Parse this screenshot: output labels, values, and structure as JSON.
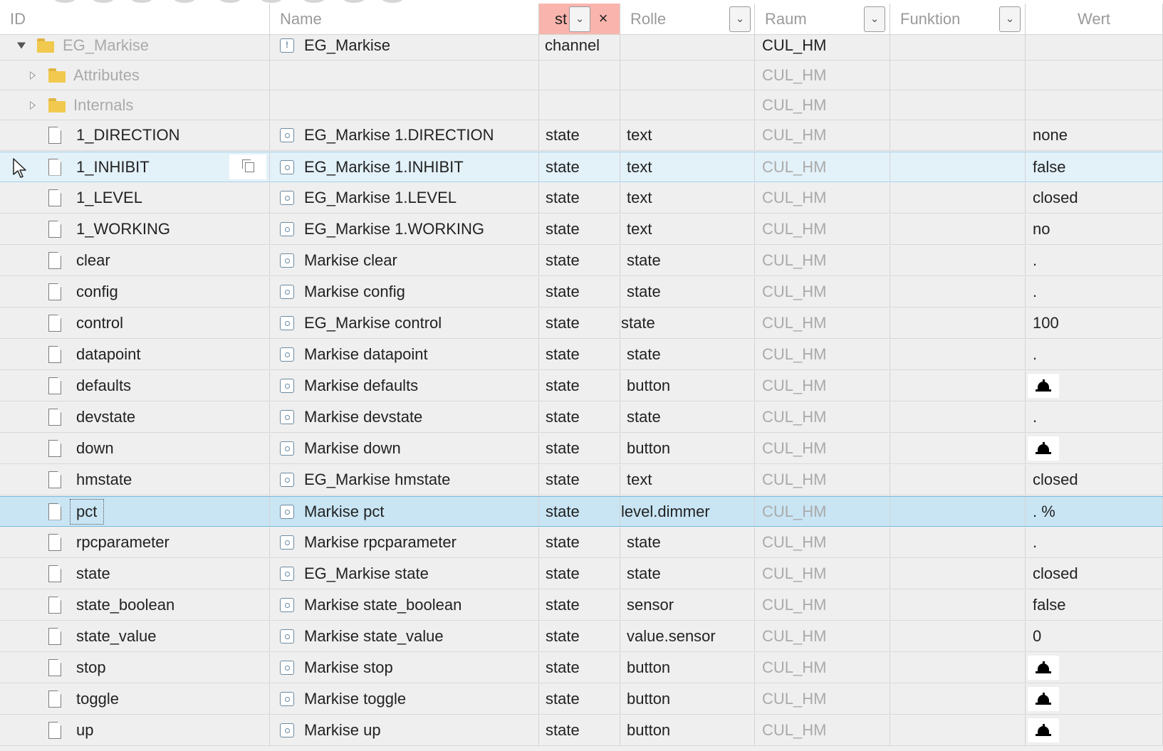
{
  "columns": {
    "id": "ID",
    "name": "Name",
    "type": "st",
    "role": "Rolle",
    "room": "Raum",
    "function": "Funktion",
    "value": "Wert"
  },
  "type_filter_clear": "×",
  "parent": {
    "id": "EG_Markise",
    "name": "EG_Markise",
    "type": "channel",
    "room": "CUL_HM"
  },
  "folders": [
    {
      "id": "Attributes",
      "room": "CUL_HM"
    },
    {
      "id": "Internals",
      "room": "CUL_HM"
    }
  ],
  "rows": [
    {
      "id": "1_DIRECTION",
      "name": "EG_Markise 1.DIRECTION",
      "type": "state",
      "role": "text",
      "room": "CUL_HM",
      "value": "none"
    },
    {
      "id": "1_INHIBIT",
      "name": "EG_Markise 1.INHIBIT",
      "type": "state",
      "role": "text",
      "room": "CUL_HM",
      "value": "false"
    },
    {
      "id": "1_LEVEL",
      "name": "EG_Markise 1.LEVEL",
      "type": "state",
      "role": "text",
      "room": "CUL_HM",
      "value": "closed"
    },
    {
      "id": "1_WORKING",
      "name": "EG_Markise 1.WORKING",
      "type": "state",
      "role": "text",
      "room": "CUL_HM",
      "value": "no"
    },
    {
      "id": "clear",
      "name": "Markise clear",
      "type": "state",
      "role": "state",
      "room": "CUL_HM",
      "value": "."
    },
    {
      "id": "config",
      "name": "Markise config",
      "type": "state",
      "role": "state",
      "room": "CUL_HM",
      "value": "."
    },
    {
      "id": "control",
      "name": "EG_Markise control",
      "type": "state",
      "role": "state",
      "room": "CUL_HM",
      "value": "100"
    },
    {
      "id": "datapoint",
      "name": "Markise datapoint",
      "type": "state",
      "role": "state",
      "room": "CUL_HM",
      "value": "."
    },
    {
      "id": "defaults",
      "name": "Markise defaults",
      "type": "state",
      "role": "button",
      "room": "CUL_HM",
      "value": ""
    },
    {
      "id": "devstate",
      "name": "Markise devstate",
      "type": "state",
      "role": "state",
      "room": "CUL_HM",
      "value": "."
    },
    {
      "id": "down",
      "name": "Markise down",
      "type": "state",
      "role": "button",
      "room": "CUL_HM",
      "value": ""
    },
    {
      "id": "hmstate",
      "name": "EG_Markise hmstate",
      "type": "state",
      "role": "text",
      "room": "CUL_HM",
      "value": "closed"
    },
    {
      "id": "pct",
      "name": "Markise pct",
      "type": "state",
      "role": "level.dimmer",
      "room": "CUL_HM",
      "value": ". %"
    },
    {
      "id": "rpcparameter",
      "name": "Markise rpcparameter",
      "type": "state",
      "role": "state",
      "room": "CUL_HM",
      "value": "."
    },
    {
      "id": "state",
      "name": "EG_Markise state",
      "type": "state",
      "role": "state",
      "room": "CUL_HM",
      "value": "closed"
    },
    {
      "id": "state_boolean",
      "name": "Markise state_boolean",
      "type": "state",
      "role": "sensor",
      "room": "CUL_HM",
      "value": "false"
    },
    {
      "id": "state_value",
      "name": "Markise state_value",
      "type": "state",
      "role": "value.sensor",
      "room": "CUL_HM",
      "value": "0"
    },
    {
      "id": "stop",
      "name": "Markise stop",
      "type": "state",
      "role": "button",
      "room": "CUL_HM",
      "value": ""
    },
    {
      "id": "toggle",
      "name": "Markise toggle",
      "type": "state",
      "role": "button",
      "room": "CUL_HM",
      "value": ""
    },
    {
      "id": "up",
      "name": "Markise up",
      "type": "state",
      "role": "button",
      "room": "CUL_HM",
      "value": ""
    }
  ],
  "hover_row_id": "1_INHIBIT",
  "selected_row_id": "pct",
  "colors": {
    "filter_header": "#f9b5ad",
    "hover_row": "#e3f1f9",
    "selected_row": "#c9e5f4",
    "folder": "#f1c94e"
  },
  "icons": {
    "folder": "folder-icon",
    "file": "file-icon",
    "state": "state-icon",
    "channel": "channel-icon",
    "button_value": "bell-icon",
    "copy": "copy-icon",
    "cursor": "mouse-pointer-icon"
  }
}
